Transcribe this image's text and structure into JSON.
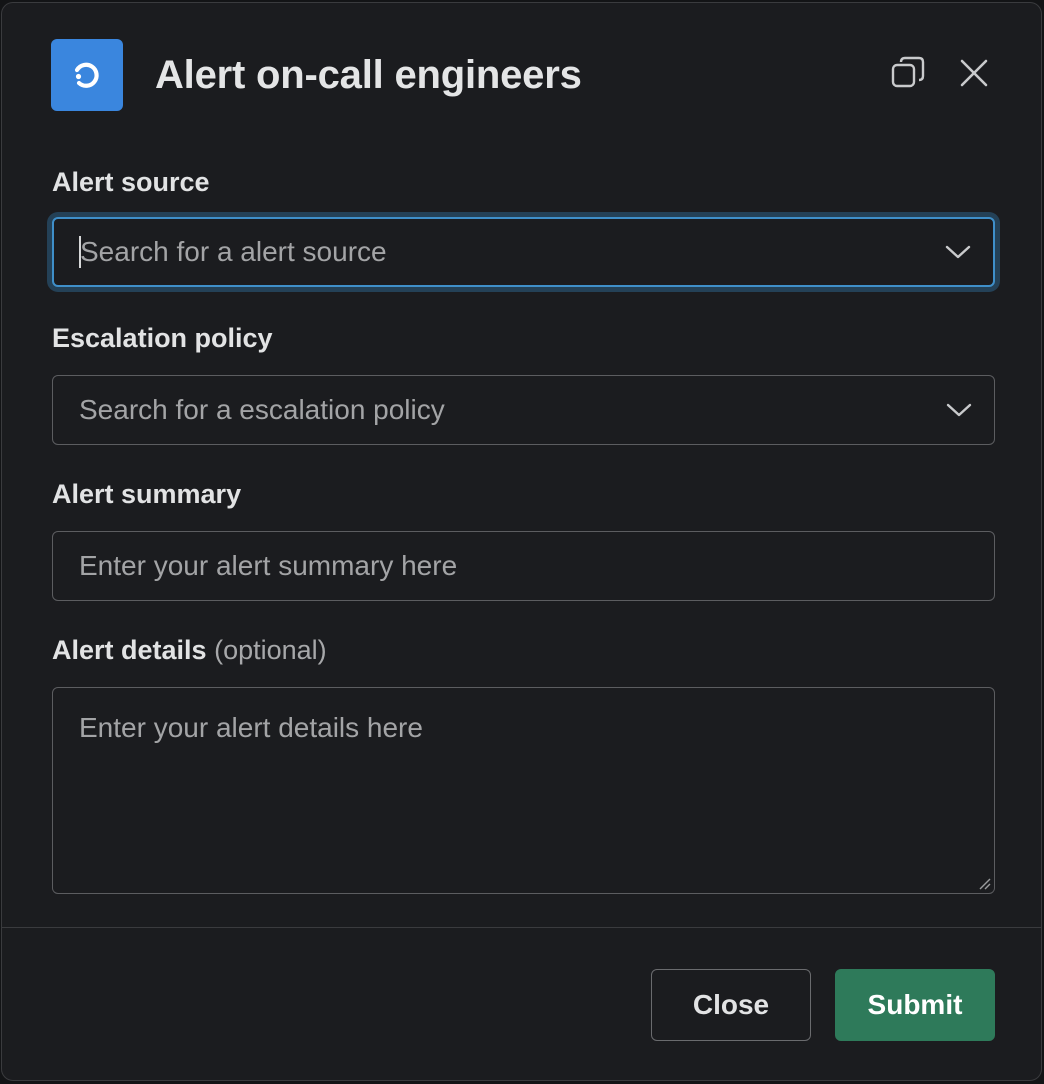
{
  "modal": {
    "title": "Alert on-call engineers",
    "app_icon": "rootly-loop-icon",
    "accent_color": "#3a86de"
  },
  "header_actions": {
    "popout_icon": "popout-window-icon",
    "close_icon": "close-icon"
  },
  "fields": {
    "alert_source": {
      "label": "Alert source",
      "placeholder": "Search for a alert source"
    },
    "escalation_policy": {
      "label": "Escalation policy",
      "placeholder": "Search for a escalation policy"
    },
    "alert_summary": {
      "label": "Alert summary",
      "placeholder": "Enter your alert summary here"
    },
    "alert_details": {
      "label": "Alert details",
      "optional": "(optional)",
      "placeholder": "Enter your alert details here"
    }
  },
  "footer": {
    "close_label": "Close",
    "submit_label": "Submit",
    "submit_color": "#2e7a5a"
  }
}
